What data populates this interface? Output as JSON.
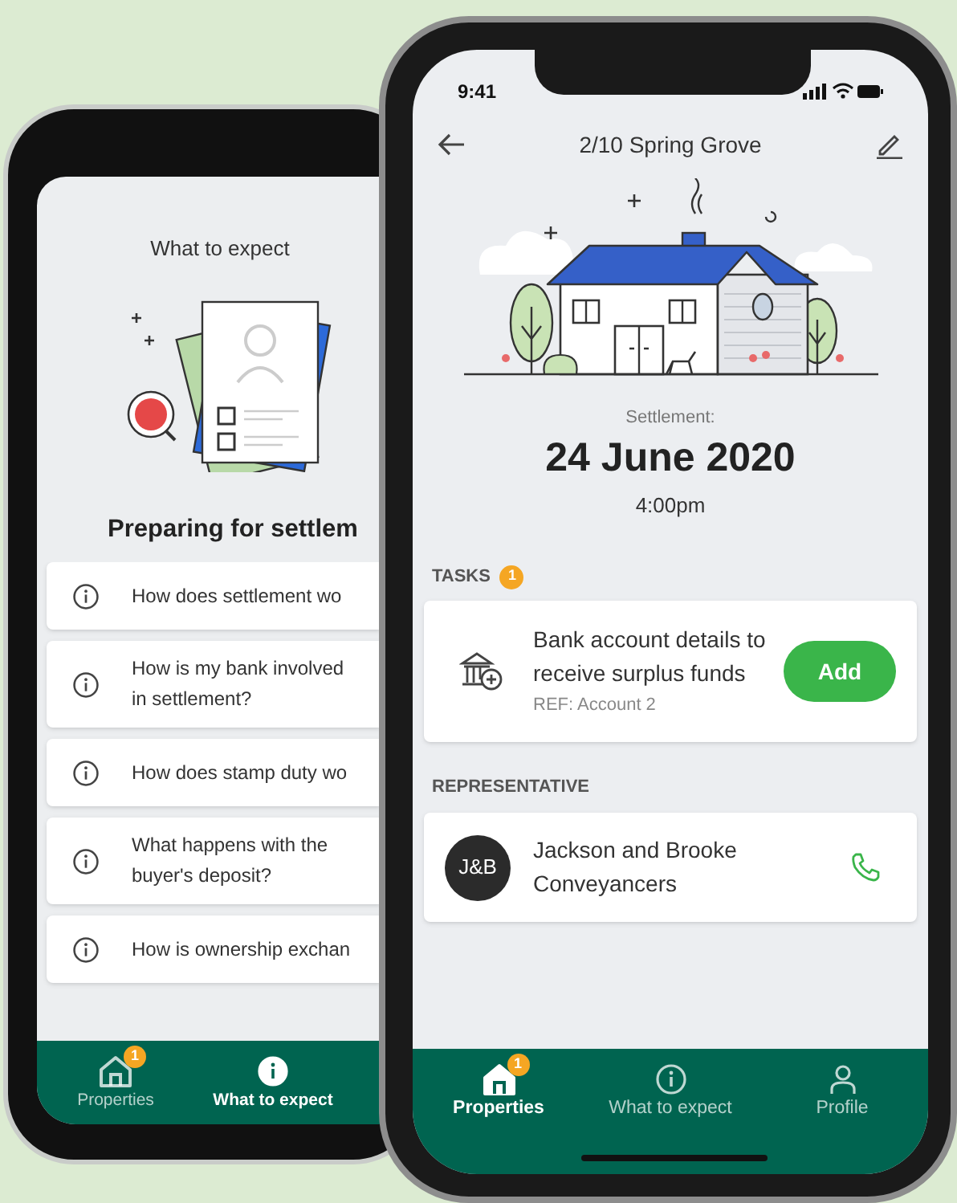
{
  "left_phone": {
    "title": "What to expect",
    "heading": "Preparing for settlem",
    "questions": [
      {
        "text": "How does settlement wo"
      },
      {
        "text": "How is my bank involved in settlement?"
      },
      {
        "text": "How does stamp duty wo"
      },
      {
        "text": "What happens with the buyer's deposit?"
      },
      {
        "text": "How is ownership exchan"
      }
    ],
    "tab_bar": [
      {
        "label": "Properties",
        "badge": "1",
        "selected": false
      },
      {
        "label": "What to expect",
        "selected": true
      }
    ]
  },
  "right_phone": {
    "status_bar": {
      "time": "9:41"
    },
    "header": {
      "title": "2/10 Spring Grove"
    },
    "settlement": {
      "label": "Settlement:",
      "date": "24 June 2020",
      "time": "4:00pm"
    },
    "tasks": {
      "heading": "TASKS",
      "count": "1",
      "items": [
        {
          "title": "Bank account details to receive surplus funds",
          "ref": "REF: Account 2",
          "action": "Add"
        }
      ]
    },
    "representative": {
      "heading": "REPRESENTATIVE",
      "initials": "J&B",
      "name": "Jackson and Brooke Conveyancers"
    },
    "tab_bar": [
      {
        "label": "Properties",
        "badge": "1",
        "selected": true
      },
      {
        "label": "What to expect",
        "selected": false
      },
      {
        "label": "Profile",
        "selected": false
      }
    ]
  }
}
